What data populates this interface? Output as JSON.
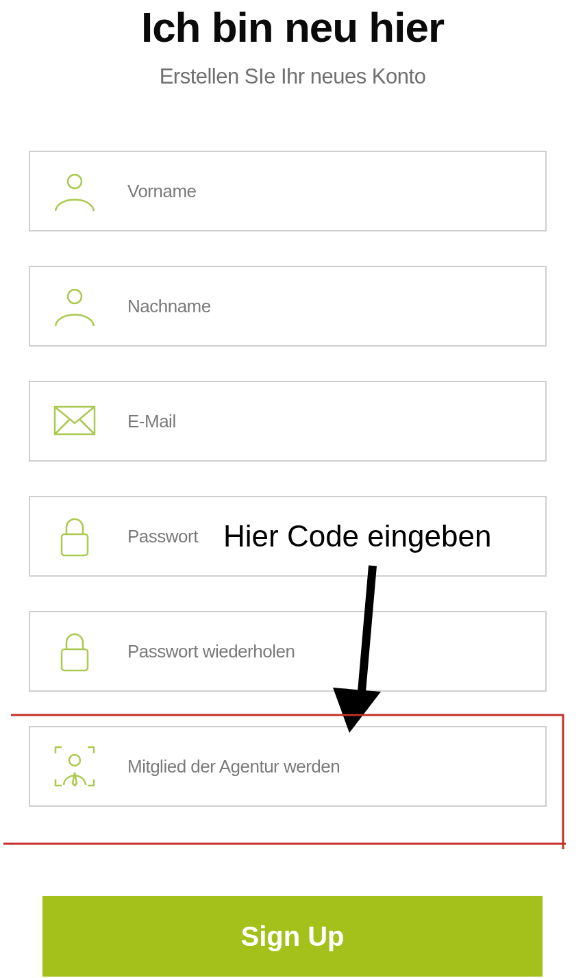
{
  "title": "Ich bin neu hier",
  "subtitle": "Erstellen SIe Ihr neues Konto",
  "fields": [
    {
      "kind": "name",
      "placeholder": "Vorname"
    },
    {
      "kind": "name",
      "placeholder": "Nachname"
    },
    {
      "kind": "email",
      "placeholder": "E-Mail"
    },
    {
      "kind": "password",
      "placeholder": "Passwort"
    },
    {
      "kind": "password",
      "placeholder": "Passwort wiederholen"
    },
    {
      "kind": "agency",
      "placeholder": "Mitglied der Agentur werden"
    }
  ],
  "annotation": {
    "text": "Hier Code eingeben"
  },
  "submit_button": "Sign Up"
}
